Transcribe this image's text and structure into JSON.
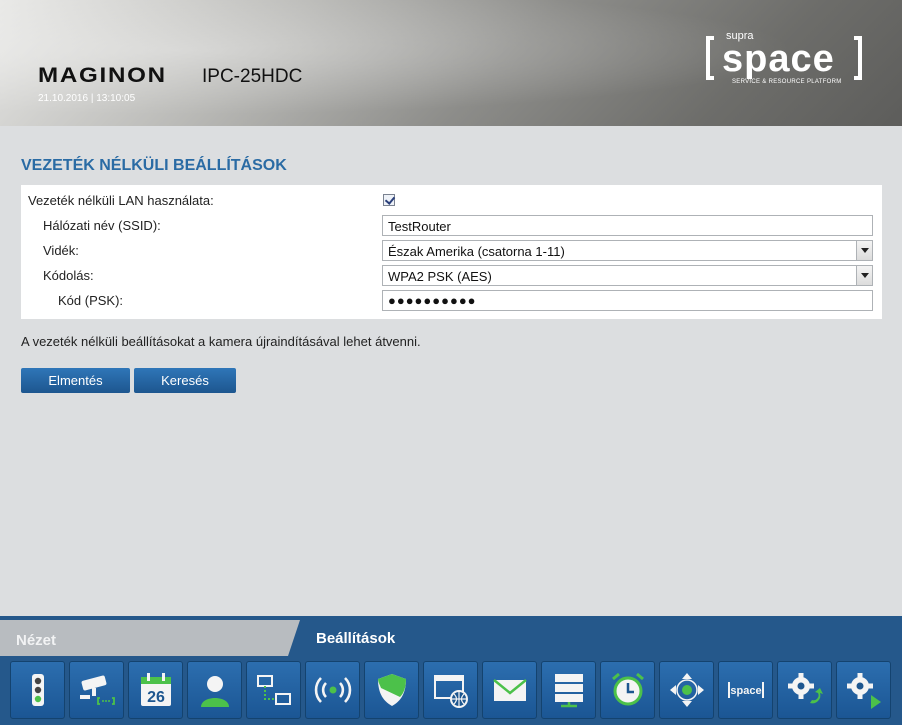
{
  "header": {
    "brand": "MAGINON",
    "model": "IPC-25HDC",
    "datetime": "21.10.2016 | 13:10:05",
    "logo": {
      "supra": "supra",
      "word": "space",
      "tagline": "SERVICE & RESOURCE PLATFORM"
    }
  },
  "main": {
    "title": "VEZETÉK NÉLKÜLI BEÁLLÍTÁSOK",
    "fields": {
      "wlan_label": "Vezeték nélküli LAN használata:",
      "wlan_checked": true,
      "ssid_label": "Hálózati név (SSID):",
      "ssid_value": "TestRouter",
      "region_label": "Vidék:",
      "region_value": "Észak Amerika (csatorna 1-11)",
      "encryption_label": "Kódolás:",
      "encryption_value": "WPA2 PSK (AES)",
      "psk_label": "Kód (PSK):",
      "psk_value": "●●●●●●●●●●"
    },
    "note": "A vezeték nélküli beállításokat a kamera újraindításával lehet átvenni.",
    "buttons": {
      "save": "Elmentés",
      "search": "Keresés"
    }
  },
  "bottom": {
    "tabs": {
      "view": "Nézet",
      "settings": "Beállítások"
    },
    "calendar_day": "26",
    "space_icon_text": "space",
    "toolbar_icons": [
      "status-light-icon",
      "camera-icon",
      "calendar-icon",
      "user-icon",
      "network-icon",
      "wireless-icon",
      "shield-icon",
      "web-settings-icon",
      "mail-icon",
      "storage-icon",
      "alarm-clock-icon",
      "ptz-control-icon",
      "supra-space-icon",
      "settings-gear-icon",
      "settings-next-icon"
    ]
  },
  "colors": {
    "accent": "#2a6ba4",
    "toolbar": "#25588b",
    "button": "#1d568f"
  }
}
